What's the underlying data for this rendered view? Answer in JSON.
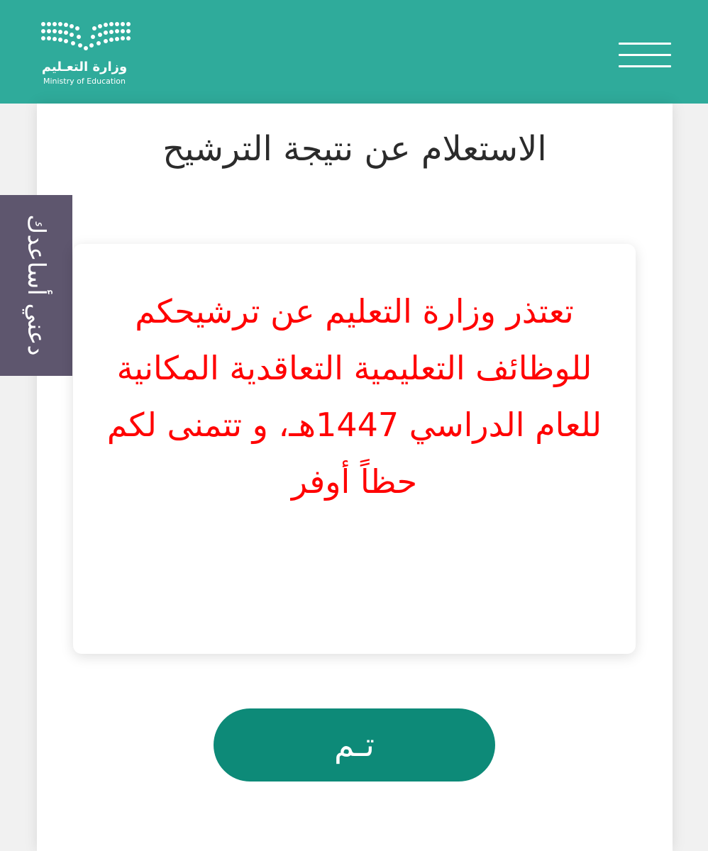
{
  "header": {
    "logo_ar": "وزارة التعـليم",
    "logo_en": "Ministry of Education",
    "background": "#2fab9b"
  },
  "page": {
    "title": "الاستعلام عن نتيجة الترشيح"
  },
  "help_tab": {
    "label": "دعني أساعدك",
    "background": "#5e566e"
  },
  "message": {
    "text": "تعتذر وزارة التعليم عن ترشيحكم للوظائف التعليمية التعاقدية المكانية للعام الدراسي 1447هـ، و تتمنى لكم حظاً أوفر",
    "color": "#ff0000"
  },
  "actions": {
    "done_label": "تـم",
    "done_color": "#0d8a78"
  },
  "icons": {
    "logo": "ministry-dots-logo",
    "menu": "hamburger-menu-icon"
  }
}
